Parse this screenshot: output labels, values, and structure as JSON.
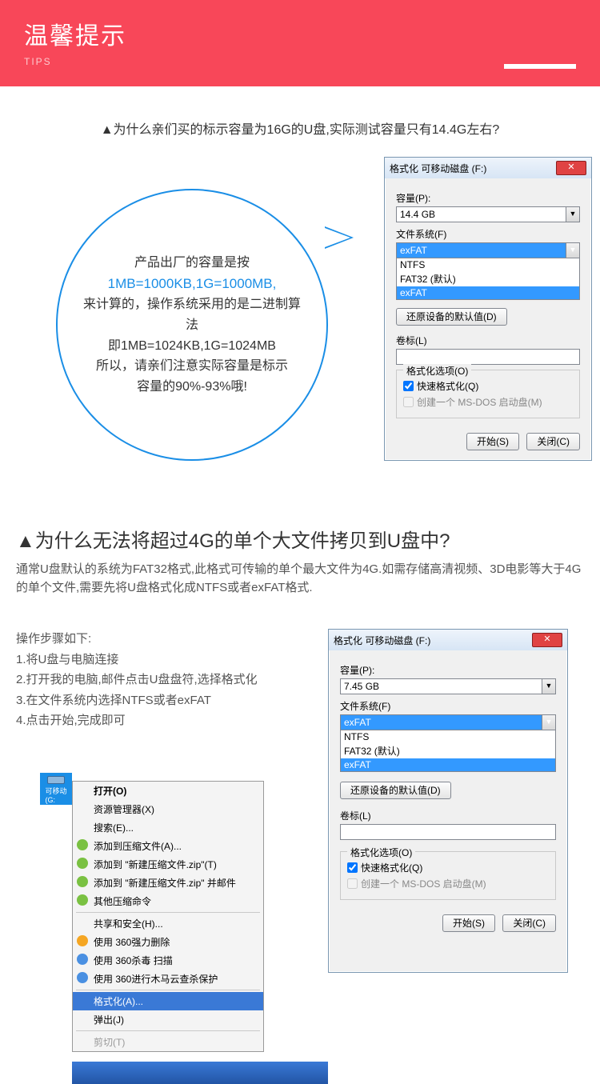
{
  "banner": {
    "title": "温馨提示",
    "sub": "TIPS"
  },
  "q1": "▲为什么亲们买的标示容量为16G的U盘,实际测试容量只有14.4G左右?",
  "bubble": {
    "l1": "产品出厂的容量是按",
    "l2": "1MB=1000KB,1G=1000MB,",
    "l3": "来计算的，操作系统采用的是二进制算法",
    "l4": "即1MB=1024KB,1G=1024MB",
    "l5": "所以，请亲们注意实际容量是标示",
    "l6": "容量的90%-93%哦!"
  },
  "dlg1": {
    "title": "格式化 可移动磁盘 (F:)",
    "capacity_label": "容量(P):",
    "capacity_value": "14.4 GB",
    "fs_label": "文件系统(F)",
    "fs_value": "exFAT",
    "fs_options": [
      "NTFS",
      "FAT32 (默认)",
      "exFAT"
    ],
    "restore_btn": "还原设备的默认值(D)",
    "volume_label": "卷标(L)",
    "opt_title": "格式化选项(O)",
    "quick_fmt": "快速格式化(Q)",
    "msdos": "创建一个 MS-DOS 启动盘(M)",
    "start": "开始(S)",
    "close": "关闭(C)"
  },
  "q2": "▲为什么无法将超过4G的单个大文件拷贝到U盘中?",
  "p2": "通常U盘默认的系统为FAT32格式,此格式可传输的单个最大文件为4G.如需存储高清视频、3D电影等大于4G的单个文件,需要先将U盘格式化成NTFS或者exFAT格式.",
  "steps": {
    "h": "操作步骤如下:",
    "s1": "1.将U盘与电脑连接",
    "s2": "2.打开我的电脑,邮件点击U盘盘符,选择格式化",
    "s3": "3.在文件系统内选择NTFS或者exFAT",
    "s4": "4.点击开始,完成即可"
  },
  "ctx": {
    "drive": "可移动\n(G:",
    "items": [
      {
        "t": "打开(O)",
        "bold": true
      },
      {
        "t": "资源管理器(X)"
      },
      {
        "t": "搜索(E)..."
      },
      {
        "t": "添加到压缩文件(A)...",
        "ic": "green"
      },
      {
        "t": "添加到 \"新建压缩文件.zip\"(T)",
        "ic": "green"
      },
      {
        "t": "添加到 \"新建压缩文件.zip\" 并邮件",
        "ic": "green"
      },
      {
        "t": "其他压缩命令",
        "ic": "green"
      },
      {
        "sep": true
      },
      {
        "t": "共享和安全(H)..."
      },
      {
        "t": "使用 360强力删除",
        "ic": "yel"
      },
      {
        "t": "使用 360杀毒 扫描",
        "ic": "blue"
      },
      {
        "t": "使用 360进行木马云查杀保护",
        "ic": "blue"
      },
      {
        "sep": true
      },
      {
        "t": "格式化(A)...",
        "sel": true
      },
      {
        "t": "弹出(J)"
      },
      {
        "sep": true
      },
      {
        "t": "剪切(T)",
        "gray": true
      }
    ]
  },
  "dlg2": {
    "title": "格式化 可移动磁盘 (F:)",
    "capacity_label": "容量(P):",
    "capacity_value": "7.45 GB",
    "fs_label": "文件系统(F)",
    "fs_value": "exFAT",
    "fs_options": [
      "NTFS",
      "FAT32 (默认)",
      "exFAT"
    ],
    "restore_btn": "还原设备的默认值(D)",
    "volume_label": "卷标(L)",
    "opt_title": "格式化选项(O)",
    "quick_fmt": "快速格式化(Q)",
    "msdos": "创建一个 MS-DOS 启动盘(M)",
    "start": "开始(S)",
    "close": "关闭(C)"
  }
}
